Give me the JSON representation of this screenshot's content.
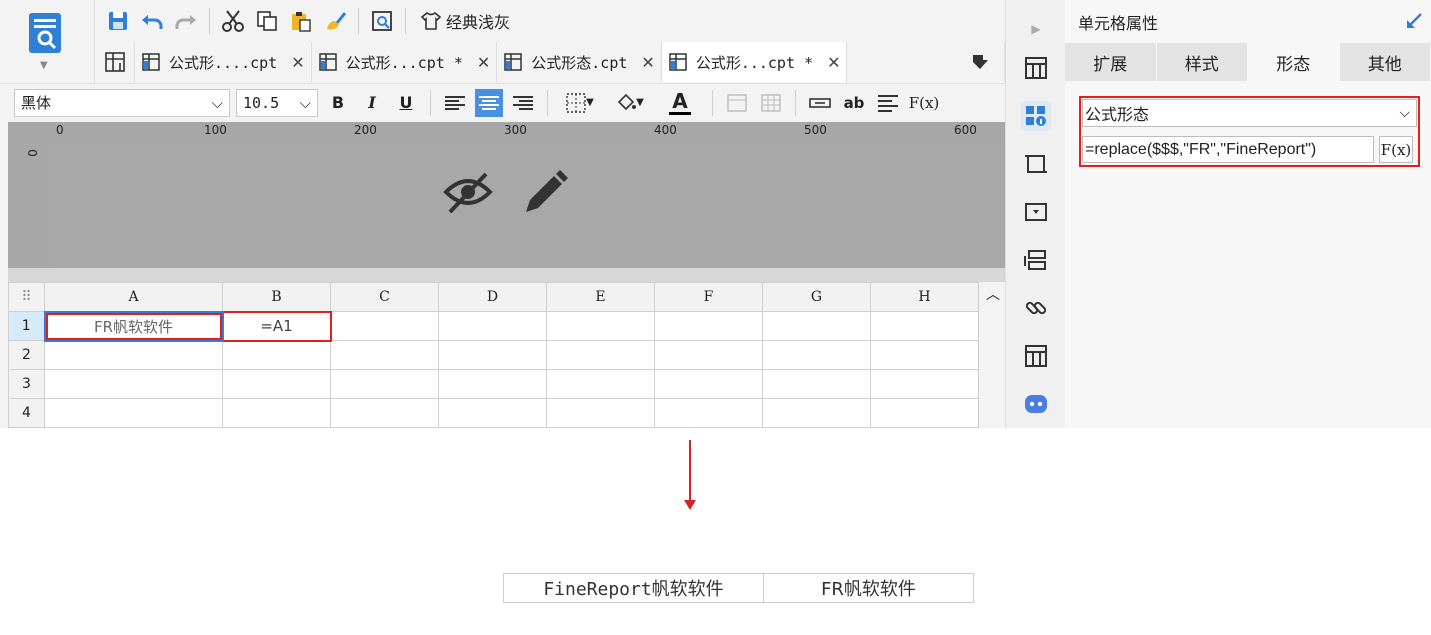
{
  "logo": {
    "icon": "report-logo-icon"
  },
  "toolbar": {
    "icons": [
      "save-icon",
      "undo-icon",
      "redo-icon",
      "cut-icon",
      "copy-icon",
      "paste-icon",
      "format-painter-icon",
      "preview-icon"
    ],
    "theme_label": "经典浅灰"
  },
  "tabs": [
    {
      "label": "公式形....cpt",
      "active": false
    },
    {
      "label": "公式形...cpt *",
      "active": false
    },
    {
      "label": "公式形态.cpt",
      "active": false
    },
    {
      "label": "公式形...cpt *",
      "active": true
    }
  ],
  "format_bar": {
    "font": "黑体",
    "size": "10.5",
    "bold": "B",
    "italic": "I",
    "underline": "U",
    "text_color_letter": "A",
    "wrap_label": "ab",
    "fx": "F(x)"
  },
  "ruler": {
    "ticks": [
      "0",
      "100",
      "200",
      "300",
      "400",
      "500",
      "600"
    ],
    "vertical_zero": "0"
  },
  "sheet": {
    "columns": [
      "A",
      "B",
      "C",
      "D",
      "E",
      "F",
      "G",
      "H"
    ],
    "rows": [
      {
        "num": "1",
        "cells": [
          "FR帆软软件",
          "=A1",
          "",
          "",
          "",
          "",
          "",
          ""
        ]
      },
      {
        "num": "2",
        "cells": [
          "",
          "",
          "",
          "",
          "",
          "",
          "",
          ""
        ]
      },
      {
        "num": "3",
        "cells": [
          "",
          "",
          "",
          "",
          "",
          "",
          "",
          ""
        ]
      },
      {
        "num": "4",
        "cells": [
          "",
          "",
          "",
          "",
          "",
          "",
          "",
          ""
        ]
      }
    ]
  },
  "panel": {
    "title": "单元格属性",
    "tabs": [
      "扩展",
      "样式",
      "形态",
      "其他"
    ],
    "active_tab": "形态",
    "form_type": "公式形态",
    "formula": "=replace($$$,\"FR\",\"FineReport\")",
    "fx": "F(x)"
  },
  "result": {
    "cells": [
      "FineReport帆软软件",
      "FR帆软软件"
    ]
  },
  "colors": {
    "highlight_red": "#e02020",
    "accent_blue": "#4a90e2"
  }
}
